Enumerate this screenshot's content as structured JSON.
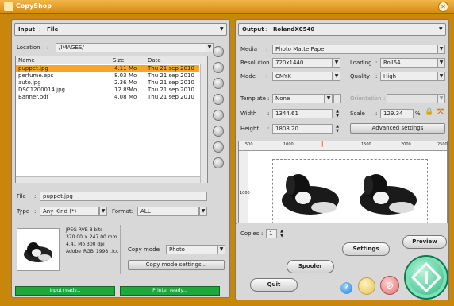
{
  "window": {
    "title": "CopyShop"
  },
  "input": {
    "label": "Input",
    "sep": ":",
    "source": "File",
    "location_label": "Location",
    "location": "/IMAGES/",
    "columns": [
      "Name",
      "Size",
      "Date"
    ],
    "files": [
      {
        "name": "puppet.jpg",
        "size": "4.11",
        "unit": "Mo",
        "date": "Thu 21 sep 2010"
      },
      {
        "name": "perfume.eps",
        "size": "8.03",
        "unit": "Mo",
        "date": "Thu 21 sep 2010"
      },
      {
        "name": "auto.jpg",
        "size": "2.36",
        "unit": "Mo",
        "date": "Thu 21 sep 2010"
      },
      {
        "name": "DSC1200014.jpg",
        "size": "12.89",
        "unit": "Mo",
        "date": "Thu 21 sep 2010"
      },
      {
        "name": "Banner.pdf",
        "size": "4.08",
        "unit": "Mo",
        "date": "Thu 21 sep 2010"
      }
    ],
    "file_label": "File",
    "file": "puppet.jpg",
    "type_label": "Type",
    "type": "Any Kind (*)",
    "format_label": "Format",
    "format": "ALL",
    "info": [
      "JPEG RVB 8 bits",
      "370.00 × 247.00 mm",
      "4.41 Mo 300 dpi",
      "Adobe_RGB_1998_.icc"
    ],
    "copy_mode_label": "Copy mode",
    "copy_mode": "Photo",
    "copy_mode_settings": "Copy mode settings...",
    "status_input": "Input ready...",
    "status_printer": "Printer ready..."
  },
  "output": {
    "label": "Output",
    "sep": ":",
    "device": "RolandXC540",
    "media_label": "Media",
    "media": "Photo Matte Paper",
    "resolution_label": "Resolution",
    "resolution": "720x1440",
    "loading_label": "Loading",
    "loading": "Roll54",
    "mode_label": "Mode",
    "mode": "CMYK",
    "quality_label": "Quality",
    "quality": "High",
    "template_label": "Template",
    "template": "None",
    "orientation_label": "Orientation",
    "width_label": "Width",
    "width": "1344.61",
    "scale_label": "Scale",
    "scale": "129.34",
    "scale_unit": "%",
    "height_label": "Height",
    "height": "1808.20",
    "advanced": "Advanced settings",
    "ruler": [
      "500",
      "1000",
      "1500",
      "2000",
      "2500"
    ],
    "ruler_v": "1000",
    "copies_label": "Copies",
    "copies": "1",
    "buttons": {
      "preview": "Preview",
      "settings": "Settings",
      "spooler": "Spooler",
      "quit": "Quit"
    }
  }
}
